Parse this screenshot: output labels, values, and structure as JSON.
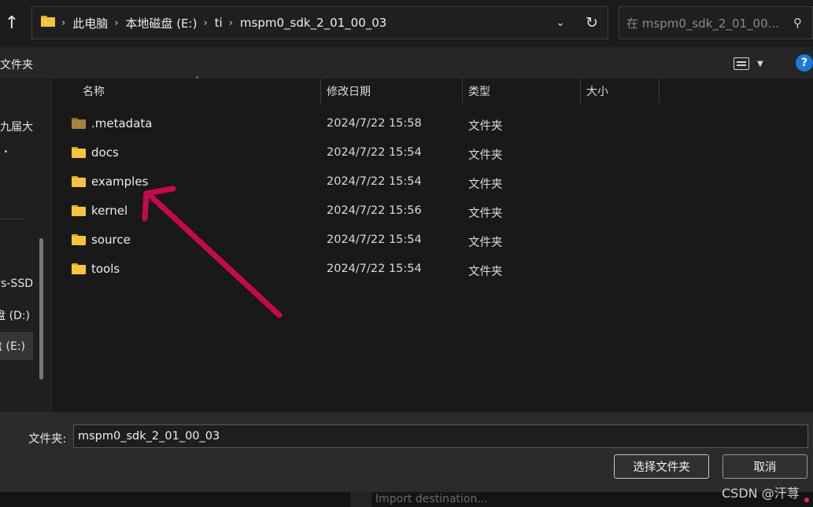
{
  "address": {
    "breadcrumbs": [
      "此电脑",
      "本地磁盘 (E:)",
      "ti",
      "mspm0_sdk_2_01_00_03"
    ]
  },
  "search": {
    "placeholder": "在 mspm0_sdk_2_01_00..."
  },
  "toolbar": {
    "new_folder_label": "新建文件夹",
    "help_label": "?"
  },
  "nav": {
    "items": [
      {
        "label": "第九届大"
      },
      {
        "label": "•"
      },
      {
        "label": "Windows-SSD"
      },
      {
        "label": "本地磁盘 (D:)"
      },
      {
        "label": "本地磁盘 (E:)"
      }
    ]
  },
  "columns": [
    "名称",
    "修改日期",
    "类型",
    "大小"
  ],
  "files": [
    {
      "name": ".metadata",
      "date": "2024/7/22 15:58",
      "type": "文件夹",
      "size": ""
    },
    {
      "name": "docs",
      "date": "2024/7/22 15:54",
      "type": "文件夹",
      "size": ""
    },
    {
      "name": "examples",
      "date": "2024/7/22 15:54",
      "type": "文件夹",
      "size": ""
    },
    {
      "name": "kernel",
      "date": "2024/7/22 15:56",
      "type": "文件夹",
      "size": ""
    },
    {
      "name": "source",
      "date": "2024/7/22 15:54",
      "type": "文件夹",
      "size": ""
    },
    {
      "name": "tools",
      "date": "2024/7/22 15:54",
      "type": "文件夹",
      "size": ""
    }
  ],
  "footer": {
    "folder_label": "文件夹:",
    "folder_value": "mspm0_sdk_2_01_00_03",
    "select_button": "选择文件夹",
    "cancel_button": "取消"
  },
  "background_window": {
    "placeholder": "Import destination..."
  },
  "watermark": "CSDN @汗荨",
  "colors": {
    "accent": "#1b7ad6",
    "annotation_arrow": "#c4094f",
    "folder": "#f4c340"
  }
}
